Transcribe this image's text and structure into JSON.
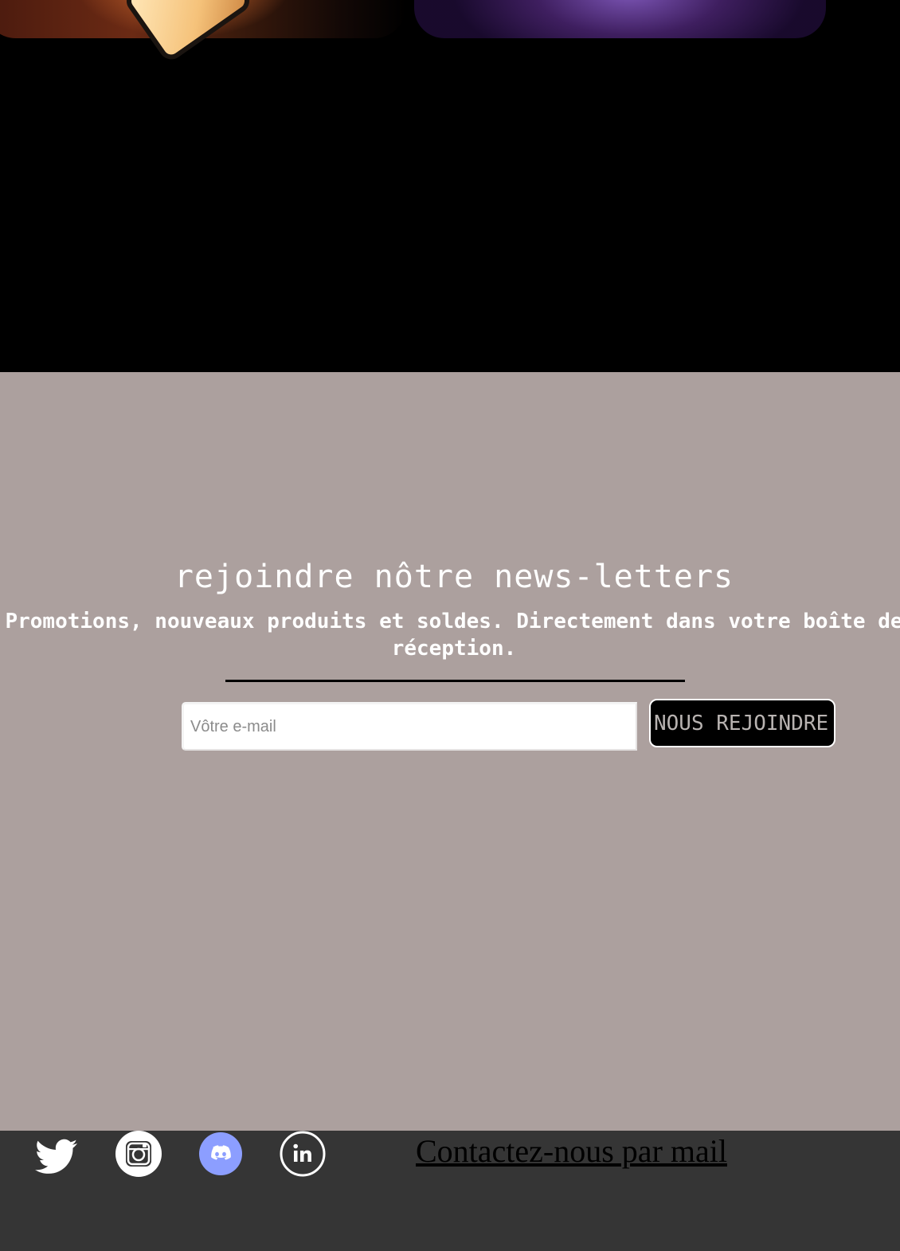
{
  "newsletter": {
    "title": "rejoindre nôtre news-letters",
    "subtitle": "Promotions, nouveaux produits et soldes. Directement dans votre boîte de réception.",
    "email_placeholder": "Vôtre e-mail",
    "email_value": "",
    "button_label": "NOUS REJOINDRE"
  },
  "footer": {
    "social_icons": [
      "twitter-icon",
      "instagram-icon",
      "discord-icon",
      "linkedin-icon"
    ],
    "contact_link": "Contactez-nous par mail"
  },
  "colors": {
    "newsletter_background": "#aca09e",
    "footer_background": "#353535",
    "discord_accent": "#8c9eff",
    "button_background": "#000000"
  }
}
